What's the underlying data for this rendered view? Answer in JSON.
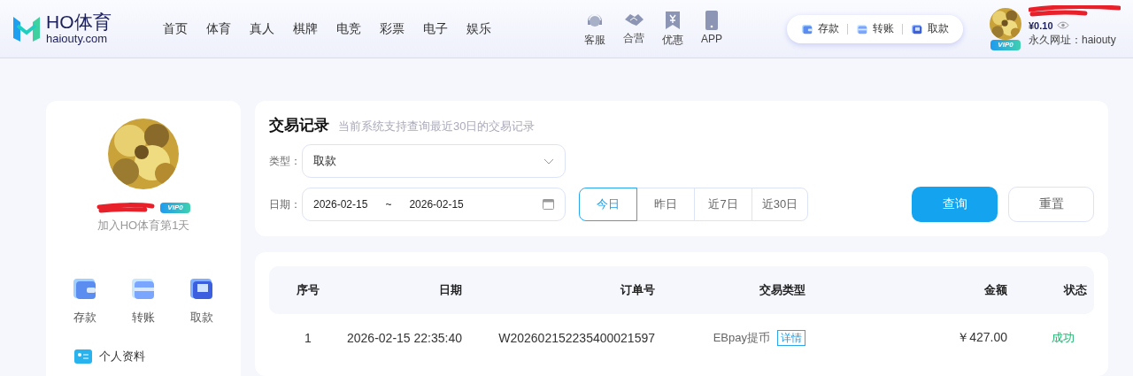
{
  "header": {
    "logo_title": "HO体育",
    "logo_domain": "haiouty.com",
    "nav": [
      {
        "label": "首页"
      },
      {
        "label": "体育"
      },
      {
        "label": "真人"
      },
      {
        "label": "棋牌"
      },
      {
        "label": "电竞"
      },
      {
        "label": "彩票"
      },
      {
        "label": "电子"
      },
      {
        "label": "娱乐"
      }
    ],
    "services": [
      {
        "label": "客服",
        "kind": "support"
      },
      {
        "label": "合营",
        "kind": "partner"
      },
      {
        "label": "优惠",
        "kind": "promo"
      },
      {
        "label": "APP",
        "kind": "app"
      }
    ],
    "wallet_actions": [
      {
        "label": "存款",
        "kind": "deposit"
      },
      {
        "label": "转账",
        "kind": "transfer"
      },
      {
        "label": "取款",
        "kind": "withdraw"
      }
    ],
    "account": {
      "vip": "VIP0",
      "balance": "¥0.10",
      "url": "永久网址：haiouty"
    }
  },
  "profile": {
    "vip": "VIP0",
    "joined": "加入HO体育第1天",
    "actions": [
      {
        "label": "存款",
        "kind": "deposit"
      },
      {
        "label": "转账",
        "kind": "transfer"
      },
      {
        "label": "取款",
        "kind": "withdraw"
      }
    ],
    "menu": [
      {
        "label": "个人资料"
      }
    ]
  },
  "filter": {
    "title": "交易记录",
    "subtitle": "当前系统支持查询最近30日的交易记录",
    "type_label": "类型：",
    "type_value": "取款",
    "date_label": "日期：",
    "date_from": "2026-02-15",
    "date_sep": "~",
    "date_to": "2026-02-15",
    "ranges": [
      {
        "label": "今日",
        "selected": true
      },
      {
        "label": "昨日",
        "selected": false
      },
      {
        "label": "近7日",
        "selected": false
      },
      {
        "label": "近30日",
        "selected": false
      }
    ],
    "query_button": "查询",
    "reset_button": "重置"
  },
  "table": {
    "columns": [
      "序号",
      "日期",
      "订单号",
      "交易类型",
      "金额",
      "状态"
    ],
    "rows": [
      {
        "index": "1",
        "date": "2026-02-15 22:35:40",
        "order": "W202602152235400021597",
        "type": "EBpay提币",
        "detail": "详情",
        "amount": "￥427.00",
        "status": "成功"
      }
    ]
  }
}
